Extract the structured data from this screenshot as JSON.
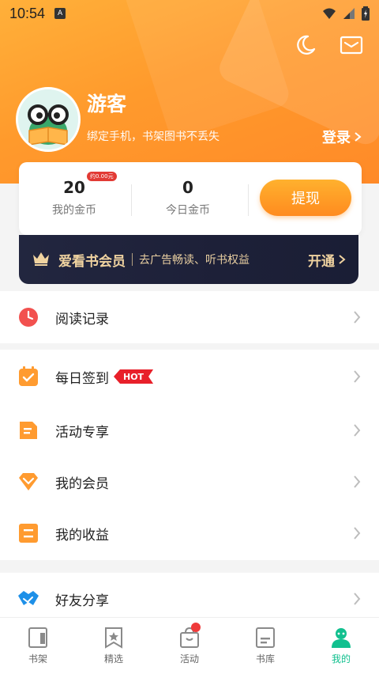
{
  "status_bar": {
    "time": "10:54",
    "notification_glyph": "A"
  },
  "header": {
    "icons": [
      "moon-icon",
      "mail-icon"
    ],
    "username": "游客",
    "subtitle": "绑定手机，书架图书不丢失",
    "login_label": "登录"
  },
  "coins": {
    "my_coins_value": "20",
    "my_coins_label": "我的金币",
    "my_coins_tag": "约0.00元",
    "today_coins_value": "0",
    "today_coins_label": "今日金币",
    "withdraw_label": "提现"
  },
  "vip": {
    "title": "爱看书会员",
    "desc": "去广告畅读、听书权益",
    "open_label": "开通"
  },
  "menu_group_1": [
    {
      "label": "阅读记录",
      "icon": "clock-icon"
    }
  ],
  "menu_group_2": [
    {
      "label": "每日签到",
      "icon": "calendar-check-icon",
      "badge": "HOT"
    },
    {
      "label": "活动专享",
      "icon": "document-icon"
    },
    {
      "label": "我的会员",
      "icon": "diamond-icon"
    },
    {
      "label": "我的收益",
      "icon": "earnings-icon"
    }
  ],
  "menu_group_3": [
    {
      "label": "好友分享",
      "icon": "handshake-icon"
    }
  ],
  "tabbar": {
    "items": [
      {
        "label": "书架",
        "icon": "bookshelf-icon"
      },
      {
        "label": "精选",
        "icon": "featured-icon"
      },
      {
        "label": "活动",
        "icon": "gift-bag-icon",
        "dot": true
      },
      {
        "label": "书库",
        "icon": "library-icon"
      },
      {
        "label": "我的",
        "icon": "profile-icon",
        "active": true
      }
    ]
  },
  "colors": {
    "accent": "#ff9a2c",
    "active_tab": "#12c08f",
    "vip_bg": "#1f233b",
    "vip_text": "#f0d3a0",
    "hot_badge": "#e8202a"
  }
}
